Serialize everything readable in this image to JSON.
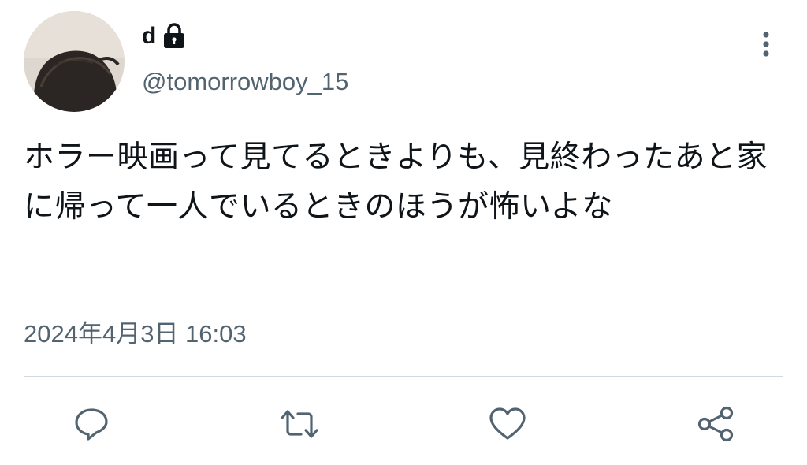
{
  "user": {
    "display_name": "d",
    "handle": "@tomorrowboy_15",
    "avatar_icon": "profile-photo",
    "protected_icon": "lock-icon"
  },
  "tweet": {
    "text": "ホラー映画って見てるときよりも、見終わったあと家に帰って一人でいるときのほうが怖いよな",
    "timestamp": "2024年4月3日 16:03"
  },
  "actions": {
    "reply_icon": "reply-icon",
    "retweet_icon": "retweet-icon",
    "like_icon": "like-icon",
    "share_icon": "share-icon"
  },
  "colors": {
    "text_primary": "#0f1419",
    "text_secondary": "#536471",
    "divider": "#cfd9de",
    "icon": "#536471"
  }
}
